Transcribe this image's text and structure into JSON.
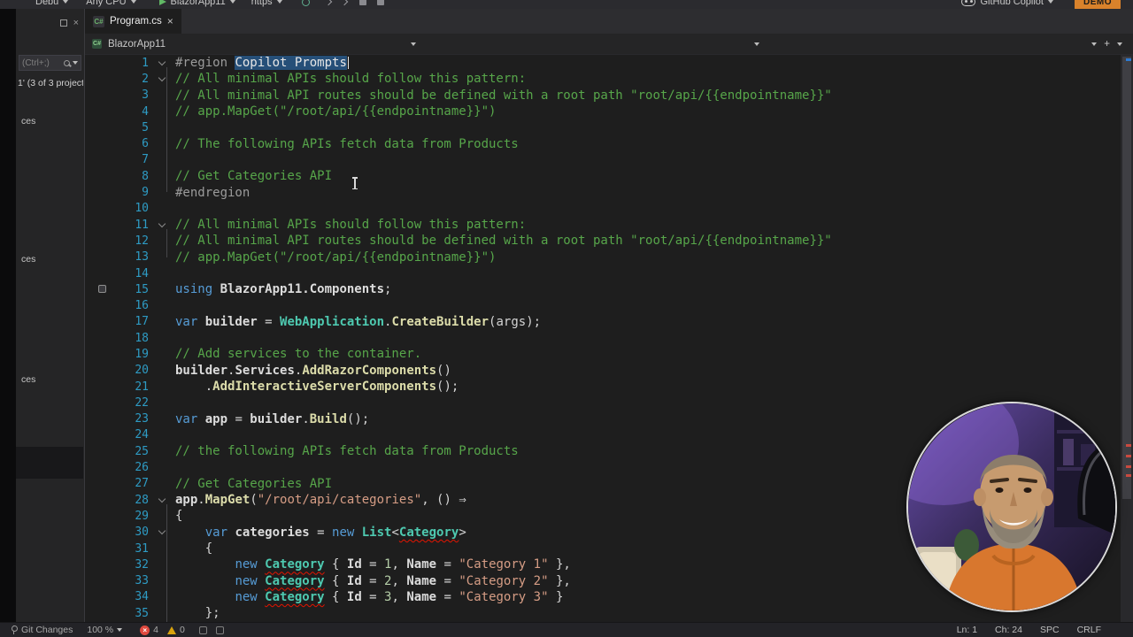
{
  "toolbar": {
    "debug": "Debu",
    "platform": "Any CPU",
    "run": "BlazorApp11",
    "profile": "https",
    "copilot": "GitHub Copilot",
    "demo": "DEMO"
  },
  "tab": {
    "label": "Program.cs",
    "close": "×"
  },
  "nav": {
    "project": "BlazorApp11",
    "plus": "+"
  },
  "panel": {
    "search_placeholder": "(Ctrl+;)",
    "solution_label": "1' (3 of 3 project",
    "items": [
      "ces",
      "ces",
      "ces"
    ],
    "close": "×"
  },
  "statusbar": {
    "git_tab": "Git Changes",
    "zoom": "100 %",
    "errors": "4",
    "warnings": "0",
    "ln": "Ln: 1",
    "ch": "Ch: 24",
    "spc": "SPC",
    "eol": "CRLF"
  },
  "colors": {
    "editor_bg": "#1E1E1E",
    "selection": "#264F78",
    "accent_orange": "#D9822B",
    "error_red": "#E04A3F",
    "warning_yellow": "#D9A30D",
    "line_number": "#2E9BC4"
  },
  "editor": {
    "lines": [
      {
        "n": 1,
        "fold": true,
        "caret": true,
        "segs": [
          [
            "pre",
            "#region "
          ],
          [
            "pre sel",
            "Copilot Prompts"
          ]
        ]
      },
      {
        "n": 2,
        "fold": true,
        "segs": [
          [
            "com",
            "// All minimal APIs should follow this pattern:"
          ]
        ]
      },
      {
        "n": 3,
        "segs": [
          [
            "com",
            "// All minimal API routes should be defined with a root path \"root/api/{{endpointname}}\""
          ]
        ]
      },
      {
        "n": 4,
        "segs": [
          [
            "com",
            "// app.MapGet(\"/root/api/{{endpointname}}\")"
          ]
        ]
      },
      {
        "n": 5,
        "segs": []
      },
      {
        "n": 6,
        "segs": [
          [
            "com",
            "// The following APIs fetch data from Products"
          ]
        ]
      },
      {
        "n": 7,
        "segs": []
      },
      {
        "n": 8,
        "segs": [
          [
            "com",
            "// Get Categories API"
          ]
        ]
      },
      {
        "n": 9,
        "segs": [
          [
            "pre",
            "#endregion"
          ]
        ]
      },
      {
        "n": 10,
        "segs": []
      },
      {
        "n": 11,
        "fold": true,
        "segs": [
          [
            "com",
            "// All minimal APIs should follow this pattern:"
          ]
        ]
      },
      {
        "n": 12,
        "segs": [
          [
            "com",
            "// All minimal API routes should be defined with a root path \"root/api/{{endpointname}}\""
          ]
        ]
      },
      {
        "n": 13,
        "segs": [
          [
            "com",
            "// app.MapGet(\"/root/api/{{endpointname}}\")"
          ]
        ]
      },
      {
        "n": 14,
        "segs": []
      },
      {
        "n": 15,
        "icon": true,
        "segs": [
          [
            "kw",
            "using "
          ],
          [
            "id",
            "BlazorApp11.Components"
          ],
          [
            "punc",
            ";"
          ]
        ]
      },
      {
        "n": 16,
        "segs": []
      },
      {
        "n": 17,
        "segs": [
          [
            "kw",
            "var "
          ],
          [
            "id",
            "builder "
          ],
          [
            "punc",
            "= "
          ],
          [
            "type",
            "WebApplication"
          ],
          [
            "punc",
            "."
          ],
          [
            "meth",
            "CreateBuilder"
          ],
          [
            "punc",
            "("
          ],
          [
            "param",
            "args"
          ],
          [
            "punc",
            ");"
          ]
        ]
      },
      {
        "n": 18,
        "segs": []
      },
      {
        "n": 19,
        "segs": [
          [
            "com",
            "// Add services to the container."
          ]
        ]
      },
      {
        "n": 20,
        "segs": [
          [
            "id",
            "builder"
          ],
          [
            "punc",
            "."
          ],
          [
            "id",
            "Services"
          ],
          [
            "punc",
            "."
          ],
          [
            "meth",
            "AddRazorComponents"
          ],
          [
            "punc",
            "()"
          ]
        ]
      },
      {
        "n": 21,
        "segs": [
          [
            "punc",
            "    ."
          ],
          [
            "meth",
            "AddInteractiveServerComponents"
          ],
          [
            "punc",
            "();"
          ]
        ]
      },
      {
        "n": 22,
        "segs": []
      },
      {
        "n": 23,
        "segs": [
          [
            "kw",
            "var "
          ],
          [
            "id",
            "app "
          ],
          [
            "punc",
            "= "
          ],
          [
            "id",
            "builder"
          ],
          [
            "punc",
            "."
          ],
          [
            "meth",
            "Build"
          ],
          [
            "punc",
            "();"
          ]
        ]
      },
      {
        "n": 24,
        "segs": []
      },
      {
        "n": 25,
        "segs": [
          [
            "com",
            "// the following APIs fetch data from Products"
          ]
        ]
      },
      {
        "n": 26,
        "segs": []
      },
      {
        "n": 27,
        "segs": [
          [
            "com",
            "// Get Categories API"
          ]
        ]
      },
      {
        "n": 28,
        "fold": true,
        "segs": [
          [
            "id",
            "app"
          ],
          [
            "punc",
            "."
          ],
          [
            "meth",
            "MapGet"
          ],
          [
            "punc",
            "("
          ],
          [
            "str",
            "\"/root/api/categories\""
          ],
          [
            "punc",
            ", () ⇒"
          ]
        ]
      },
      {
        "n": 29,
        "segs": [
          [
            "punc",
            "{"
          ]
        ]
      },
      {
        "n": 30,
        "fold": true,
        "segs": [
          [
            "punc",
            "    "
          ],
          [
            "kw",
            "var "
          ],
          [
            "id",
            "categories "
          ],
          [
            "punc",
            "= "
          ],
          [
            "kw",
            "new "
          ],
          [
            "type",
            "List"
          ],
          [
            "punc",
            "<"
          ],
          [
            "type sq",
            "Category"
          ],
          [
            "punc",
            ">"
          ]
        ]
      },
      {
        "n": 31,
        "segs": [
          [
            "punc",
            "    {"
          ]
        ]
      },
      {
        "n": 32,
        "segs": [
          [
            "punc",
            "        "
          ],
          [
            "kw",
            "new "
          ],
          [
            "type sq",
            "Category"
          ],
          [
            "punc",
            " { "
          ],
          [
            "id",
            "Id"
          ],
          [
            "punc",
            " = "
          ],
          [
            "num",
            "1"
          ],
          [
            "punc",
            ", "
          ],
          [
            "id",
            "Name"
          ],
          [
            "punc",
            " = "
          ],
          [
            "str",
            "\"Category 1\""
          ],
          [
            "punc",
            " },"
          ]
        ]
      },
      {
        "n": 33,
        "segs": [
          [
            "punc",
            "        "
          ],
          [
            "kw",
            "new "
          ],
          [
            "type sq",
            "Category"
          ],
          [
            "punc",
            " { "
          ],
          [
            "id",
            "Id"
          ],
          [
            "punc",
            " = "
          ],
          [
            "num",
            "2"
          ],
          [
            "punc",
            ", "
          ],
          [
            "id",
            "Name"
          ],
          [
            "punc",
            " = "
          ],
          [
            "str",
            "\"Category 2\""
          ],
          [
            "punc",
            " },"
          ]
        ]
      },
      {
        "n": 34,
        "segs": [
          [
            "punc",
            "        "
          ],
          [
            "kw",
            "new "
          ],
          [
            "type sq",
            "Category"
          ],
          [
            "punc",
            " { "
          ],
          [
            "id",
            "Id"
          ],
          [
            "punc",
            " = "
          ],
          [
            "num",
            "3"
          ],
          [
            "punc",
            ", "
          ],
          [
            "id",
            "Name"
          ],
          [
            "punc",
            " = "
          ],
          [
            "str",
            "\"Category 3\""
          ],
          [
            "punc",
            " }"
          ]
        ]
      },
      {
        "n": 35,
        "segs": [
          [
            "punc",
            "    };"
          ]
        ]
      }
    ]
  }
}
